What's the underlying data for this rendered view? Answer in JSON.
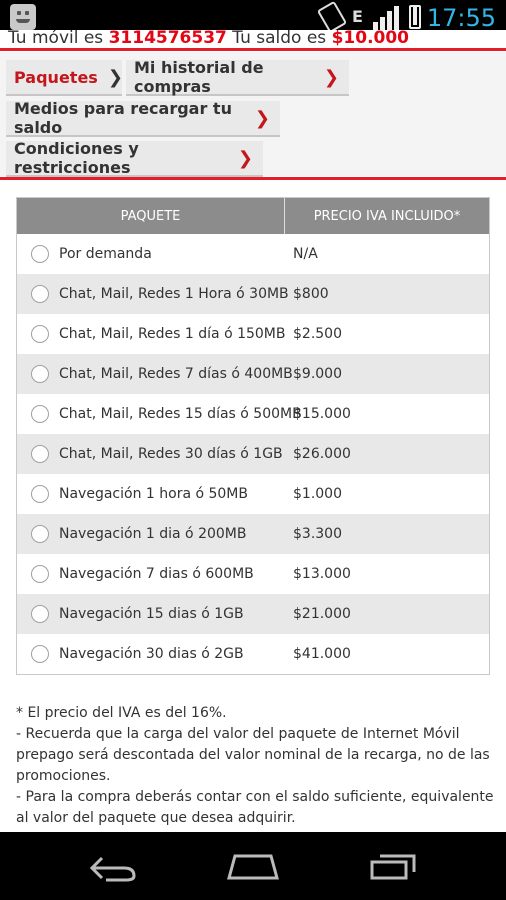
{
  "status_bar": {
    "time": "17:55",
    "network_label": "E"
  },
  "balance": {
    "prefix": "Tu móvil es ",
    "number": "3114576537",
    "middle": " Tu saldo es ",
    "amount": "$10.000"
  },
  "nav": {
    "paquetes": "Paquetes",
    "historial": "Mi historial de compras",
    "medios": "Medios para recargar tu saldo",
    "condiciones": "Condiciones y restricciones"
  },
  "table": {
    "header_paquete": "PAQUETE",
    "header_precio": "PRECIO IVA INCLUIDO*",
    "rows": [
      {
        "name": "Por demanda",
        "price": "N/A"
      },
      {
        "name": "Chat, Mail, Redes 1 Hora ó 30MB",
        "price": "$800"
      },
      {
        "name": "Chat, Mail, Redes 1 día ó 150MB",
        "price": "$2.500"
      },
      {
        "name": "Chat, Mail, Redes 7 días ó 400MB",
        "price": "$9.000"
      },
      {
        "name": "Chat, Mail, Redes 15 días ó 500MB",
        "price": "$15.000"
      },
      {
        "name": "Chat, Mail, Redes 30 días ó 1GB",
        "price": "$26.000"
      },
      {
        "name": "Navegación 1 hora ó 50MB",
        "price": "$1.000"
      },
      {
        "name": "Navegación 1 dia ó 200MB",
        "price": "$3.300"
      },
      {
        "name": "Navegación 7 dias ó 600MB",
        "price": "$13.000"
      },
      {
        "name": "Navegación 15 dias ó 1GB",
        "price": "$21.000"
      },
      {
        "name": "Navegación 30 dias ó 2GB",
        "price": "$41.000"
      }
    ]
  },
  "notes": {
    "line1": "* El precio del IVA es del 16%.",
    "line2": "- Recuerda que la carga del valor del paquete de Internet Móvil prepago será descontada del valor nominal de la recarga, no de las promociones.",
    "line3": "- Para la compra deberás contar con el saldo suficiente, equivalente al valor del paquete que desea adquirir."
  },
  "colors": {
    "brand_red": "#e31e2a",
    "status_clock": "#33b5e5"
  }
}
